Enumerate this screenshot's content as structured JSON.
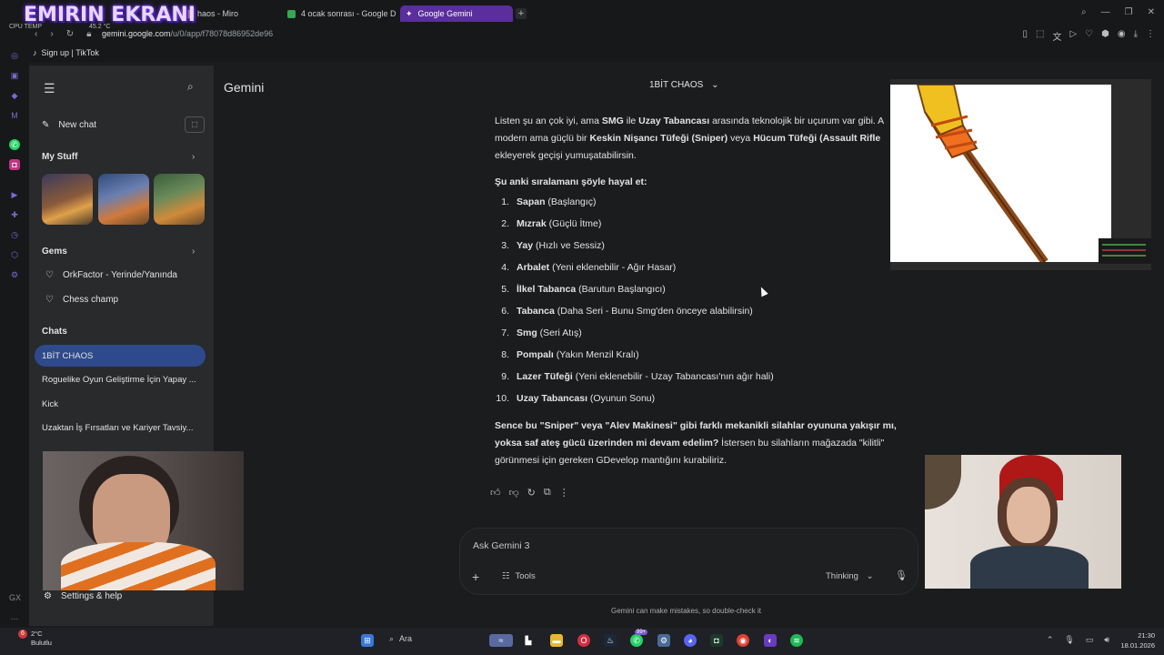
{
  "overlay": {
    "stream_title": "EMIRIN EKRANI",
    "cpu_label": "CPU TEMP",
    "cpu_value": "45.2 °C"
  },
  "browser": {
    "tabs": [
      {
        "label": "haos - Miro",
        "active": false
      },
      {
        "label": "4 ocak sonrası - Google D",
        "active": false
      },
      {
        "label": "Google Gemini",
        "active": true
      }
    ],
    "url_host": "gemini.google.com",
    "url_path": "/u/0/app/f78078d86952de96",
    "bookmark": "Sign up | TikTok"
  },
  "sidebar": {
    "new_chat": "New chat",
    "my_stuff": "My Stuff",
    "gems_title": "Gems",
    "gems": [
      "OrkFactor - Yerinde/Yanında",
      "Chess champ"
    ],
    "chats_title": "Chats",
    "chats": [
      "1BİT CHAOS",
      "Roguelike Oyun Geliştirme İçin Yapay ...",
      "Kick",
      "Uzaktan İş Fırsatları ve Kariyer Tavsiy..."
    ],
    "settings": "Settings & help"
  },
  "header": {
    "brand": "Gemini",
    "chat_title": "1BİT CHAOS"
  },
  "message": {
    "intro_a": "Listen şu an çok iyi, ama ",
    "intro_smg": "SMG",
    "intro_b": " ile ",
    "intro_uzay": "Uzay Tabancası",
    "intro_c": " arasında teknolojik bir uçurum var gibi. A",
    "intro_d": "modern ama güçlü bir ",
    "intro_sniper": "Keskin Nişancı Tüfeği (Sniper)",
    "intro_e": " veya ",
    "intro_assault": "Hücum Tüfeği (Assault Rifle",
    "intro_f": "ekleyerek geçişi yumuşatabilirsin.",
    "list_heading": "Şu anki sıralamanı şöyle hayal et:",
    "items": [
      {
        "num": "1.",
        "name": "Sapan",
        "desc": " (Başlangıç)"
      },
      {
        "num": "2.",
        "name": "Mızrak",
        "desc": " (Güçlü İtme)"
      },
      {
        "num": "3.",
        "name": "Yay",
        "desc": " (Hızlı ve Sessiz)"
      },
      {
        "num": "4.",
        "name": "Arbalet",
        "desc": " (Yeni eklenebilir - Ağır Hasar)"
      },
      {
        "num": "5.",
        "name": "İlkel Tabanca",
        "desc": " (Barutun Başlangıcı)"
      },
      {
        "num": "6.",
        "name": "Tabanca",
        "desc": " (Daha Seri - Bunu Smg'den önceye alabilirsin)"
      },
      {
        "num": "7.",
        "name": "Smg",
        "desc": " (Seri Atış)"
      },
      {
        "num": "8.",
        "name": "Pompalı",
        "desc": " (Yakın Menzil Kralı)"
      },
      {
        "num": "9.",
        "name": "Lazer Tüfeği",
        "desc": " (Yeni eklenebilir - Uzay Tabancası'nın ağır hali)"
      },
      {
        "num": "10.",
        "name": "Uzay Tabancası",
        "desc": " (Oyunun Sonu)"
      }
    ],
    "closing_bold": "Sence bu \"Sniper\" veya \"Alev Makinesi\" gibi farklı mekanikli silahlar oyununa yakışır mı, yoksa saf ateş gücü üzerinden mi devam edelim?",
    "closing_rest": " İstersen bu silahların mağazada \"kilitli\" görünmesi için gereken GDevelop mantığını kurabiliriz."
  },
  "input": {
    "placeholder": "Ask Gemini 3",
    "tools": "Tools",
    "mode": "Thinking"
  },
  "disclaimer": "Gemini can make mistakes, so double-check it",
  "taskbar": {
    "weather_temp": "2°C",
    "weather_desc": "Bulutlu",
    "weather_badge": "6",
    "search": "Ara",
    "badge": "99+",
    "time": "21:30",
    "date": "18.01.2026"
  },
  "colors": {
    "active_tab": "#5a2e9c",
    "active_chat": "#2e4a8c",
    "sidebar_bg": "#282a2c",
    "main_bg": "#1b1c1e"
  }
}
